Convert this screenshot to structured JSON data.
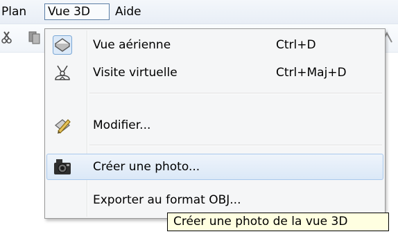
{
  "menubar": {
    "items": [
      {
        "label": "Plan"
      },
      {
        "label": "Vue 3D",
        "open": true
      },
      {
        "label": "Aide"
      }
    ]
  },
  "toolbar": {
    "icons": [
      "cut-icon",
      "copy-icon",
      "toolbar-icon"
    ]
  },
  "dropdown": {
    "items": [
      {
        "label": "Vue aérienne",
        "shortcut": "Ctrl+D",
        "icon": "aerial-view-icon"
      },
      {
        "label": "Visite virtuelle",
        "shortcut": "Ctrl+Maj+D",
        "icon": "virtual-visit-icon"
      },
      {
        "label": "Modifier...",
        "shortcut": "",
        "icon": "edit-3d-icon"
      },
      {
        "label": "Créer une photo...",
        "shortcut": "",
        "icon": "camera-icon",
        "highlighted": true
      },
      {
        "label": "Exporter au format OBJ...",
        "shortcut": "",
        "icon": ""
      }
    ]
  },
  "tooltip": {
    "text": "Créer une photo de la vue 3D"
  },
  "colors": {
    "highlight_border": "#a8c8ec",
    "tooltip_bg": "#ffffe1",
    "menu_bg": "#f5f6f7"
  }
}
